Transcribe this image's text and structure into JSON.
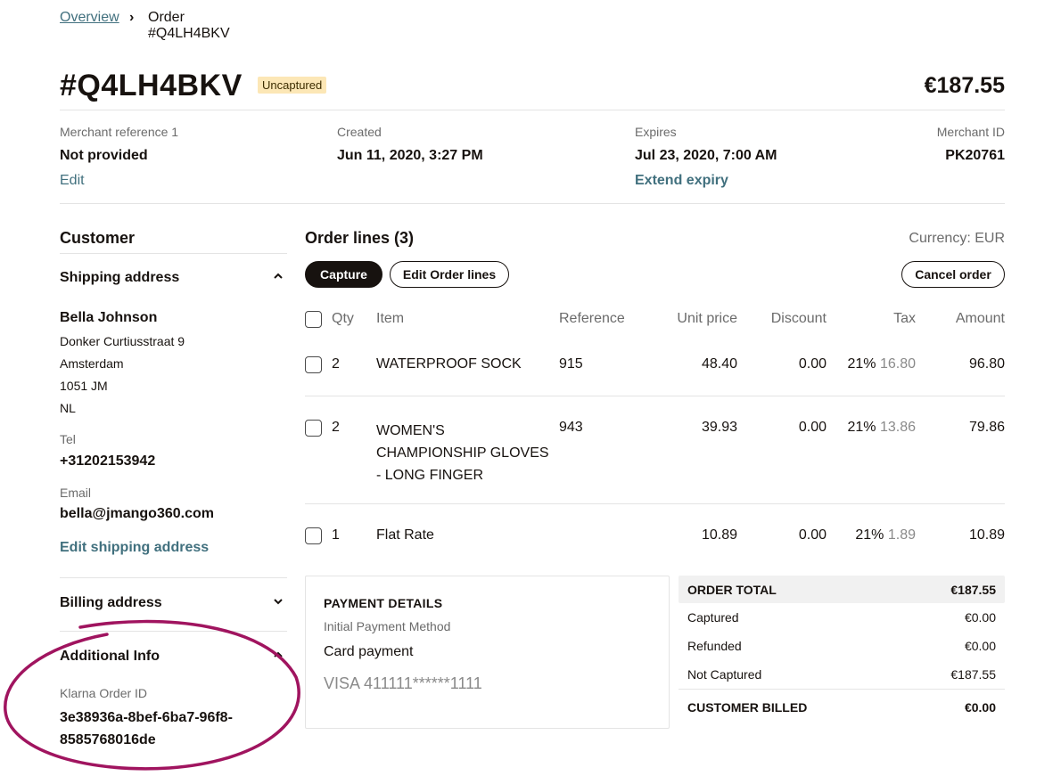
{
  "breadcrumb": {
    "overview": "Overview",
    "separator": "›",
    "current": "Order #Q4LH4BKV"
  },
  "order": {
    "title": "#Q4LH4BKV",
    "status": "Uncaptured",
    "total": "€187.55"
  },
  "meta": {
    "merchant_reference": {
      "label": "Merchant reference 1",
      "value": "Not provided",
      "action": "Edit"
    },
    "created": {
      "label": "Created",
      "value": "Jun 11, 2020, 3:27 PM"
    },
    "expires": {
      "label": "Expires",
      "value": "Jul 23, 2020, 7:00 AM",
      "action": "Extend expiry"
    },
    "merchant_id": {
      "label": "Merchant ID",
      "value": "PK20761"
    }
  },
  "customer": {
    "heading": "Customer",
    "shipping": {
      "heading": "Shipping address",
      "name": "Bella Johnson",
      "street": "Donker Curtiusstraat 9",
      "city": "Amsterdam",
      "postcode": "1051 JM",
      "country": "NL",
      "tel_label": "Tel",
      "tel": "+31202153942",
      "email_label": "Email",
      "email": "bella@jmango360.com",
      "edit_action": "Edit shipping address"
    },
    "billing": {
      "heading": "Billing address"
    },
    "additional": {
      "heading": "Additional Info",
      "klarna_label": "Klarna Order ID",
      "klarna_id_line1": "3e38936a-8bef-6ba7-96f8-",
      "klarna_id_line2": "8585768016de"
    }
  },
  "order_lines": {
    "heading": "Order lines (3)",
    "currency": "Currency: EUR",
    "buttons": {
      "capture": "Capture",
      "edit": "Edit Order lines",
      "cancel": "Cancel order"
    },
    "columns": {
      "qty": "Qty",
      "item": "Item",
      "reference": "Reference",
      "unit_price": "Unit price",
      "discount": "Discount",
      "tax": "Tax",
      "amount": "Amount"
    },
    "rows": [
      {
        "qty": "2",
        "item_lines": [
          "WATERPROOF SOCK"
        ],
        "reference": "915",
        "unit_price": "48.40",
        "discount": "0.00",
        "tax_rate": "21%",
        "tax_amount": "16.80",
        "amount": "96.80"
      },
      {
        "qty": "2",
        "item_lines": [
          "WOMEN'S",
          "CHAMPIONSHIP GLOVES",
          "- LONG FINGER"
        ],
        "reference": "943",
        "unit_price": "39.93",
        "discount": "0.00",
        "tax_rate": "21%",
        "tax_amount": "13.86",
        "amount": "79.86"
      },
      {
        "qty": "1",
        "item_lines": [
          "Flat Rate"
        ],
        "reference": "",
        "unit_price": "10.89",
        "discount": "0.00",
        "tax_rate": "21%",
        "tax_amount": "1.89",
        "amount": "10.89"
      }
    ]
  },
  "payment": {
    "heading": "PAYMENT DETAILS",
    "method_label": "Initial Payment Method",
    "method": "Card payment",
    "card": "VISA 411111******1111"
  },
  "totals": {
    "order_total": {
      "label": "ORDER TOTAL",
      "value": "€187.55"
    },
    "captured": {
      "label": "Captured",
      "value": "€0.00"
    },
    "refunded": {
      "label": "Refunded",
      "value": "€0.00"
    },
    "not_captured": {
      "label": "Not Captured",
      "value": "€187.55"
    },
    "customer_billed": {
      "label": "CUSTOMER BILLED",
      "value": "€0.00"
    }
  },
  "colors": {
    "link": "#41707e",
    "badge": "#fce7b6",
    "annotation": "#a0145f",
    "text": "#17120f"
  }
}
